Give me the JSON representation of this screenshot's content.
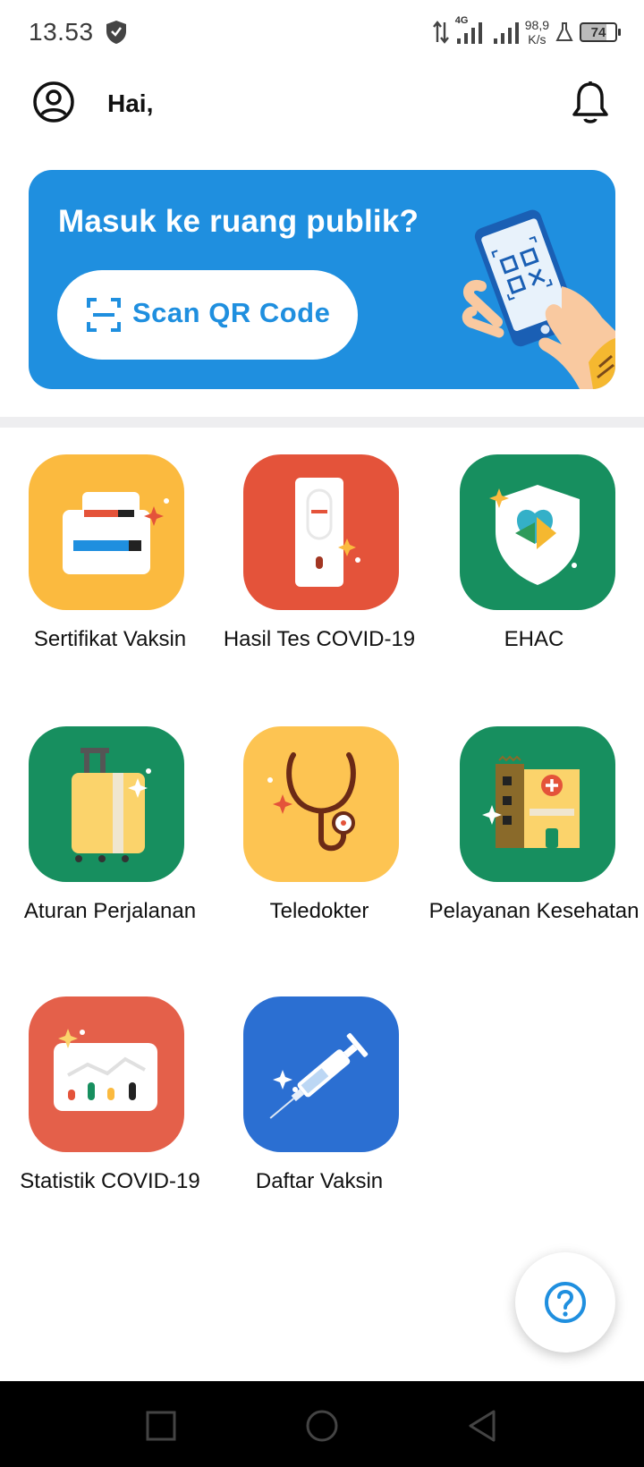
{
  "status_bar": {
    "time": "13.53",
    "network_type": "4G",
    "net_speed_value": "98,9",
    "net_speed_unit": "K/s",
    "battery": "74"
  },
  "header": {
    "greeting": "Hai,",
    "icons": [
      "profile-icon",
      "bell-icon"
    ]
  },
  "banner": {
    "title": "Masuk ke ruang publik?",
    "button_label": "Scan QR Code",
    "button_icon": "scan-icon",
    "bg_color": "#1f8fdf"
  },
  "menu": {
    "items": [
      {
        "label": "Sertifikat Vaksin",
        "icon": "certificate-icon",
        "color": "#fbba3f"
      },
      {
        "label": "Hasil Tes COVID-19",
        "icon": "test-kit-icon",
        "color": "#e4533a"
      },
      {
        "label": "EHAC",
        "icon": "shield-icon",
        "color": "#178f5f"
      },
      {
        "label": "Aturan Perjalanan",
        "icon": "suitcase-icon",
        "color": "#178f5f"
      },
      {
        "label": "Teledokter",
        "icon": "stethoscope-icon",
        "color": "#fdc452"
      },
      {
        "label": "Pelayanan Kesehatan",
        "icon": "hospital-icon",
        "color": "#178f5f"
      },
      {
        "label": "Statistik COVID-19",
        "icon": "chart-icon",
        "color": "#e4604a"
      },
      {
        "label": "Daftar Vaksin",
        "icon": "syringe-icon",
        "color": "#2b6fd2"
      }
    ]
  },
  "help_button": {
    "icon": "help-icon",
    "color": "#1f8fdf"
  },
  "nav_bar": {
    "buttons": [
      "recents-icon",
      "home-icon",
      "back-icon"
    ]
  }
}
